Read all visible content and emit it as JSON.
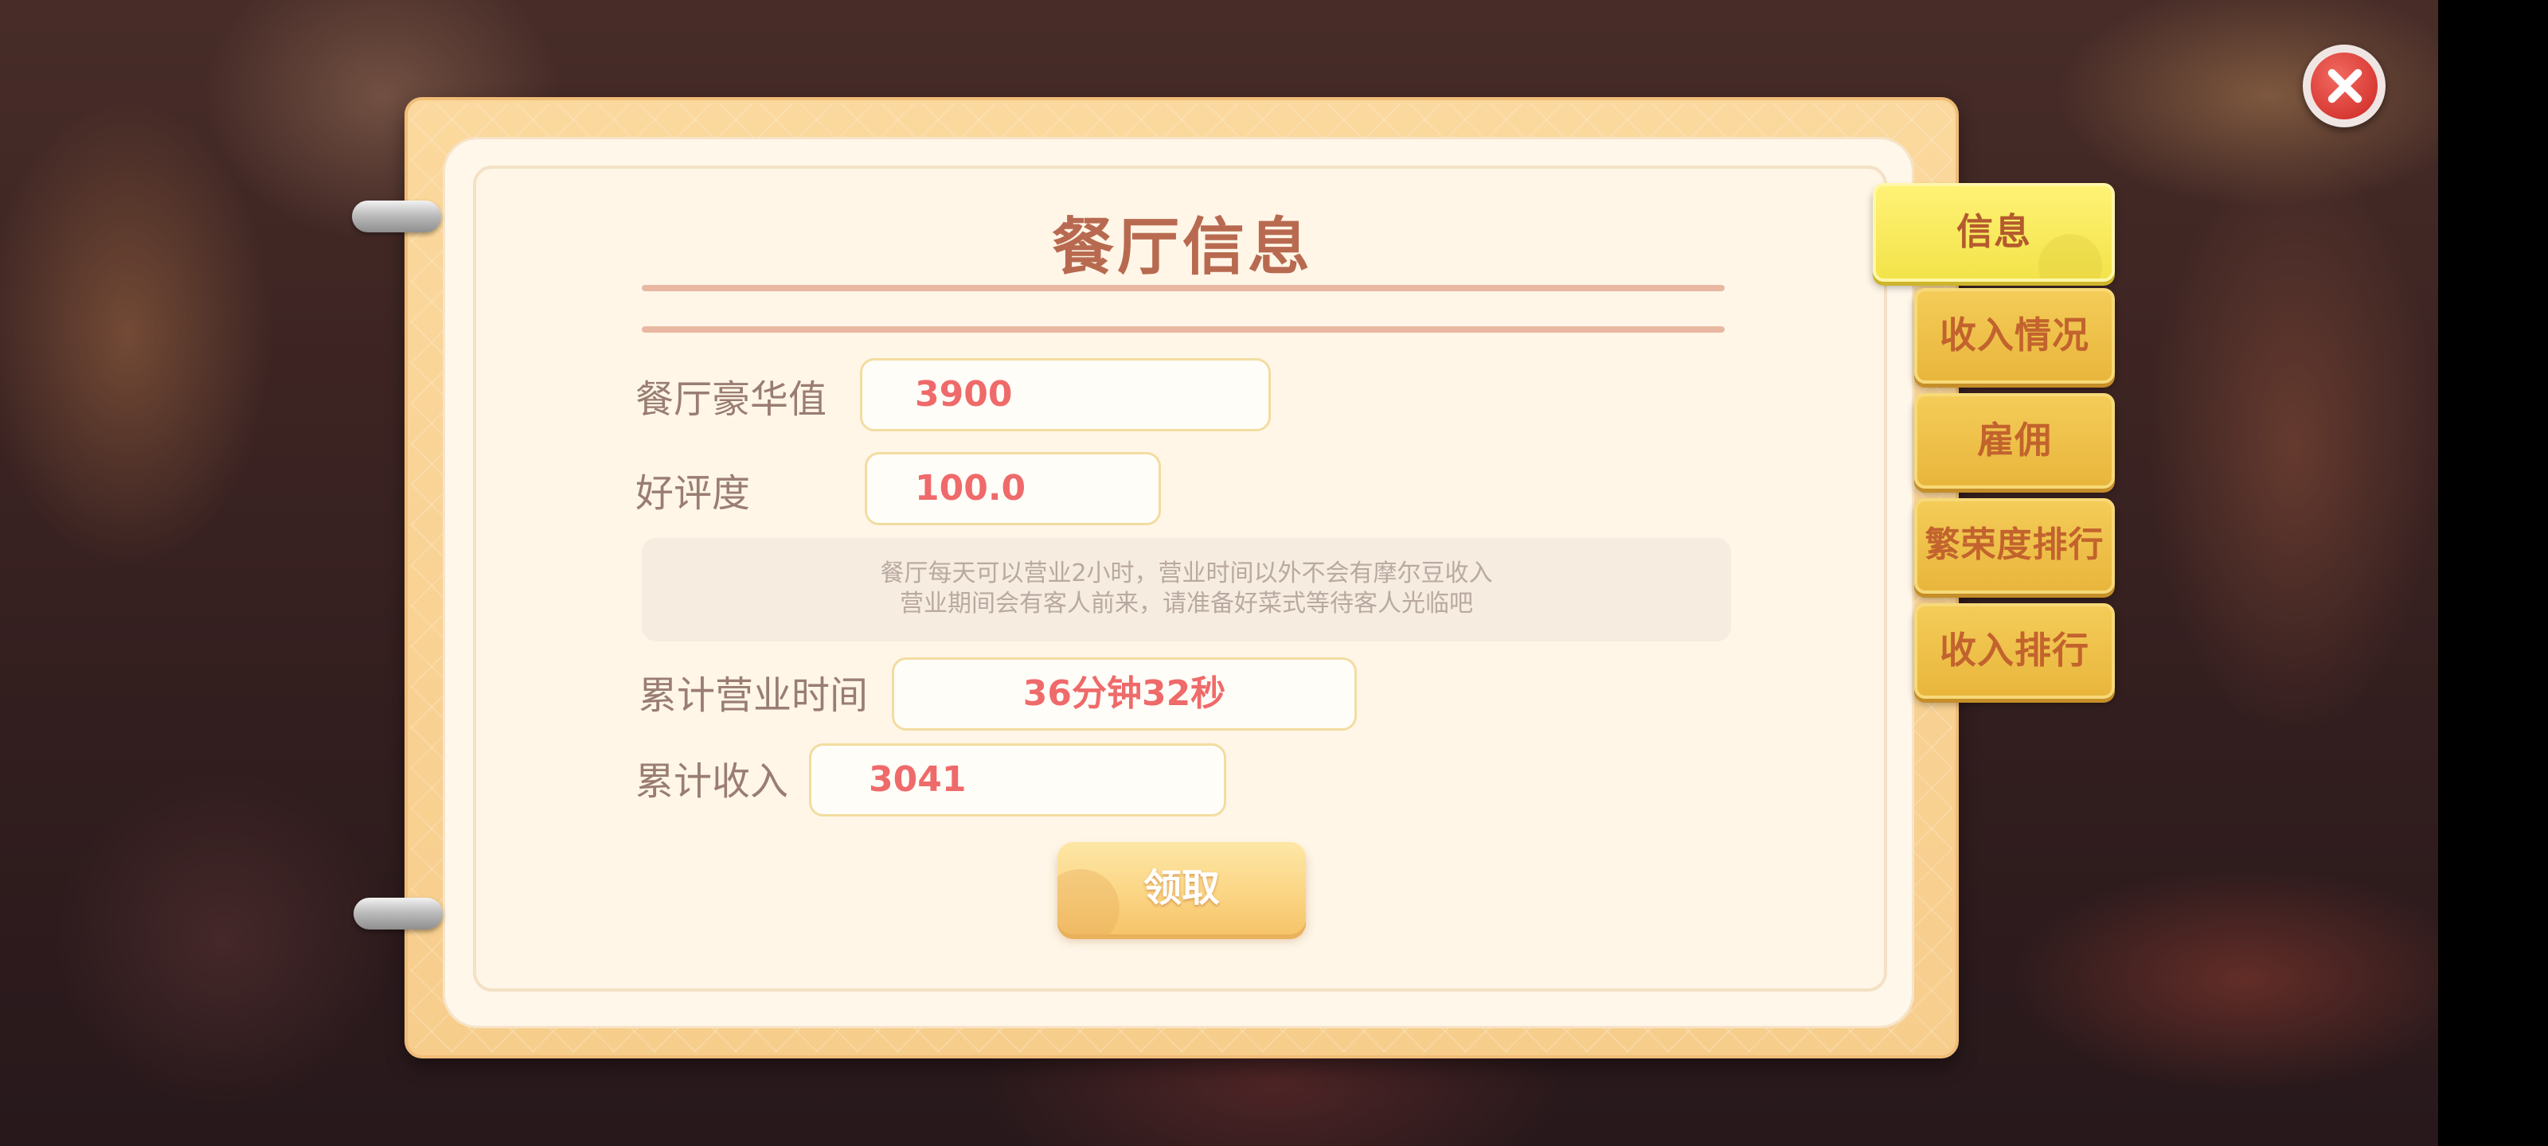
{
  "header": {
    "title": "餐厅信息",
    "close_icon": "close-icon"
  },
  "tabs": [
    {
      "label": "信息",
      "active": true
    },
    {
      "label": "收入情况",
      "active": false
    },
    {
      "label": "雇佣",
      "active": false
    },
    {
      "label": "繁荣度排行",
      "active": false
    },
    {
      "label": "收入排行",
      "active": false
    }
  ],
  "fields": {
    "luxury": {
      "label": "餐厅豪华值",
      "value": "3900"
    },
    "rating": {
      "label": "好评度",
      "value": "100.0"
    },
    "total_time": {
      "label": "累计营业时间",
      "value": "36分钟32秒"
    },
    "total_income": {
      "label": "累计收入",
      "value": "3041"
    }
  },
  "notice": {
    "line1": "餐厅每天可以营业2小时，营业时间以外不会有摩尔豆收入",
    "line2": "营业期间会有客人前来，请准备好菜式等待客人光临吧"
  },
  "actions": {
    "claim_label": "领取"
  },
  "colors": {
    "title": "#b86a50",
    "value": "#ef6a6a",
    "label": "#9a7d72",
    "tab": "#e9b63c",
    "tab_active": "#f3e34a",
    "close": "#d83a34"
  }
}
